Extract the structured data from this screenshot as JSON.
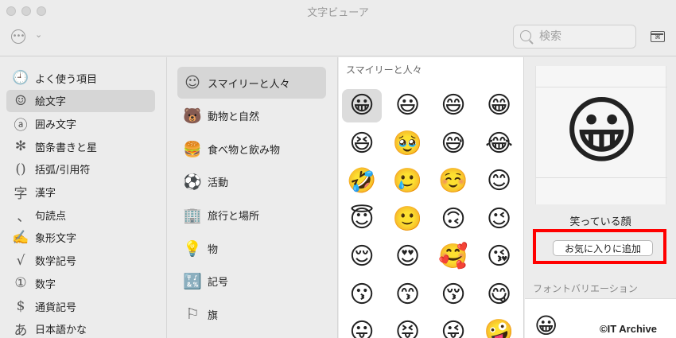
{
  "window": {
    "title": "文字ビューア"
  },
  "toolbar": {
    "more_icon": "ellipsis-circle-icon",
    "chevron_icon": "chevron-down-icon",
    "search": {
      "placeholder": "検索",
      "value": ""
    },
    "keyboard_icon": "keyboard-viewer-icon"
  },
  "sidebar": {
    "items": [
      {
        "label": "よく使う項目",
        "icon": "🕘",
        "selected": false
      },
      {
        "label": "絵文字",
        "icon": "☺",
        "selected": true
      },
      {
        "label": "囲み文字",
        "icon": "ⓐ",
        "selected": false
      },
      {
        "label": "箇条書きと星",
        "icon": "✻",
        "selected": false
      },
      {
        "label": "括弧/引用符",
        "icon": "()",
        "selected": false
      },
      {
        "label": "漢字",
        "icon": "字",
        "selected": false
      },
      {
        "label": "句読点",
        "icon": "､",
        "selected": false
      },
      {
        "label": "象形文字",
        "icon": "✍",
        "selected": false
      },
      {
        "label": "数学記号",
        "icon": "√",
        "selected": false
      },
      {
        "label": "数字",
        "icon": "①",
        "selected": false
      },
      {
        "label": "通貨記号",
        "icon": "$",
        "selected": false
      },
      {
        "label": "日本語かな",
        "icon": "あ",
        "selected": false
      }
    ]
  },
  "categories": {
    "items": [
      {
        "label": "スマイリーと人々",
        "icon": "☺",
        "selected": true
      },
      {
        "label": "動物と自然",
        "icon": "🐻",
        "selected": false
      },
      {
        "label": "食べ物と飲み物",
        "icon": "🍔",
        "selected": false
      },
      {
        "label": "活動",
        "icon": "⚽",
        "selected": false
      },
      {
        "label": "旅行と場所",
        "icon": "🏢",
        "selected": false
      },
      {
        "label": "物",
        "icon": "💡",
        "selected": false
      },
      {
        "label": "記号",
        "icon": "🔣",
        "selected": false
      },
      {
        "label": "旗",
        "icon": "⚐",
        "selected": false
      }
    ]
  },
  "grid": {
    "title": "スマイリーと人々",
    "emojis": [
      "😀",
      "😃",
      "😄",
      "😁",
      "😆",
      "🥹",
      "😅",
      "😂",
      "🤣",
      "🥲",
      "☺️",
      "😊",
      "😇",
      "🙂",
      "🙃",
      "😉",
      "😌",
      "😍",
      "🥰",
      "😘",
      "😗",
      "😙",
      "😚",
      "😋",
      "😛",
      "😝",
      "😜",
      "🤪"
    ],
    "selected_index": 0
  },
  "detail": {
    "preview_emoji": "😀",
    "name": "笑っている顔",
    "favorite_button": "お気に入りに追加",
    "font_variation_title": "フォントバリエーション",
    "variations": [
      "😀"
    ]
  },
  "watermark": "©IT Archive"
}
